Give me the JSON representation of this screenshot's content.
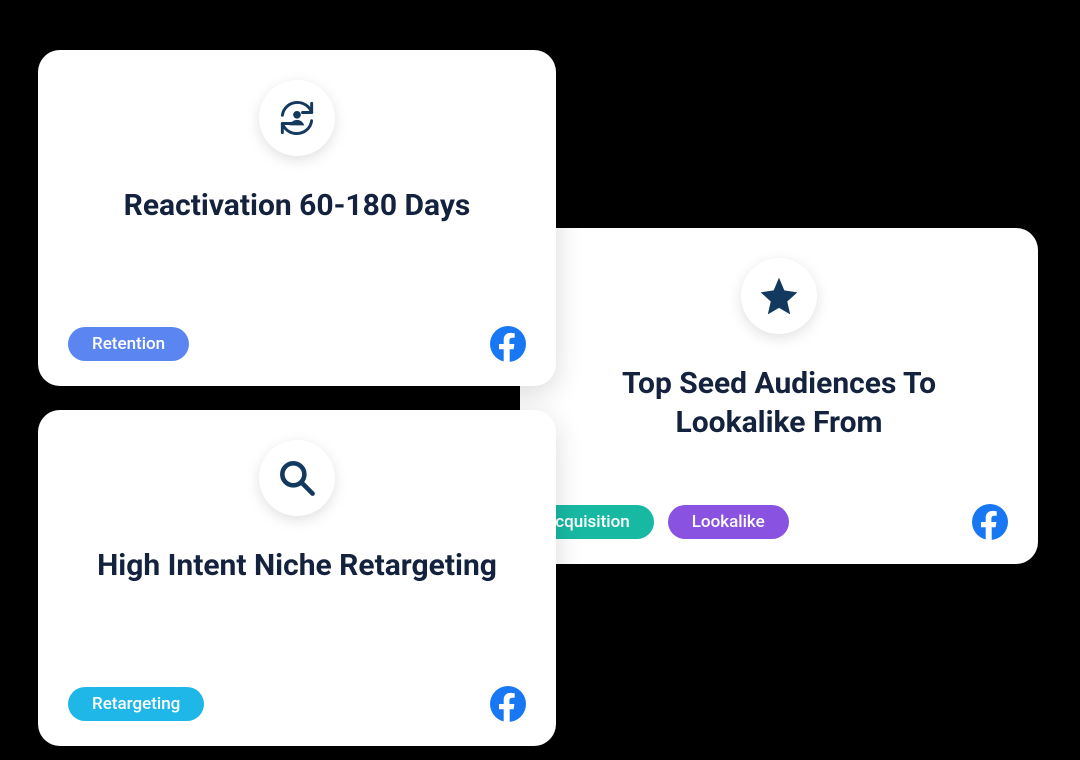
{
  "cards": [
    {
      "title": "Reactivation 60-180 Days",
      "icon": "reactivation-cycle-icon",
      "tags": [
        {
          "label": "Retention",
          "color": "#5b86f2"
        }
      ],
      "platform": "facebook"
    },
    {
      "title": "High Intent Niche Retargeting",
      "icon": "search-icon",
      "tags": [
        {
          "label": "Retargeting",
          "color": "#1fb6e8"
        }
      ],
      "platform": "facebook"
    },
    {
      "title": "Top Seed Audiences To Lookalike From",
      "icon": "star-icon",
      "tags": [
        {
          "label": "Acquisition",
          "color": "#18b9a3"
        },
        {
          "label": "Lookalike",
          "color": "#8a52e0"
        }
      ],
      "platform": "facebook"
    }
  ]
}
